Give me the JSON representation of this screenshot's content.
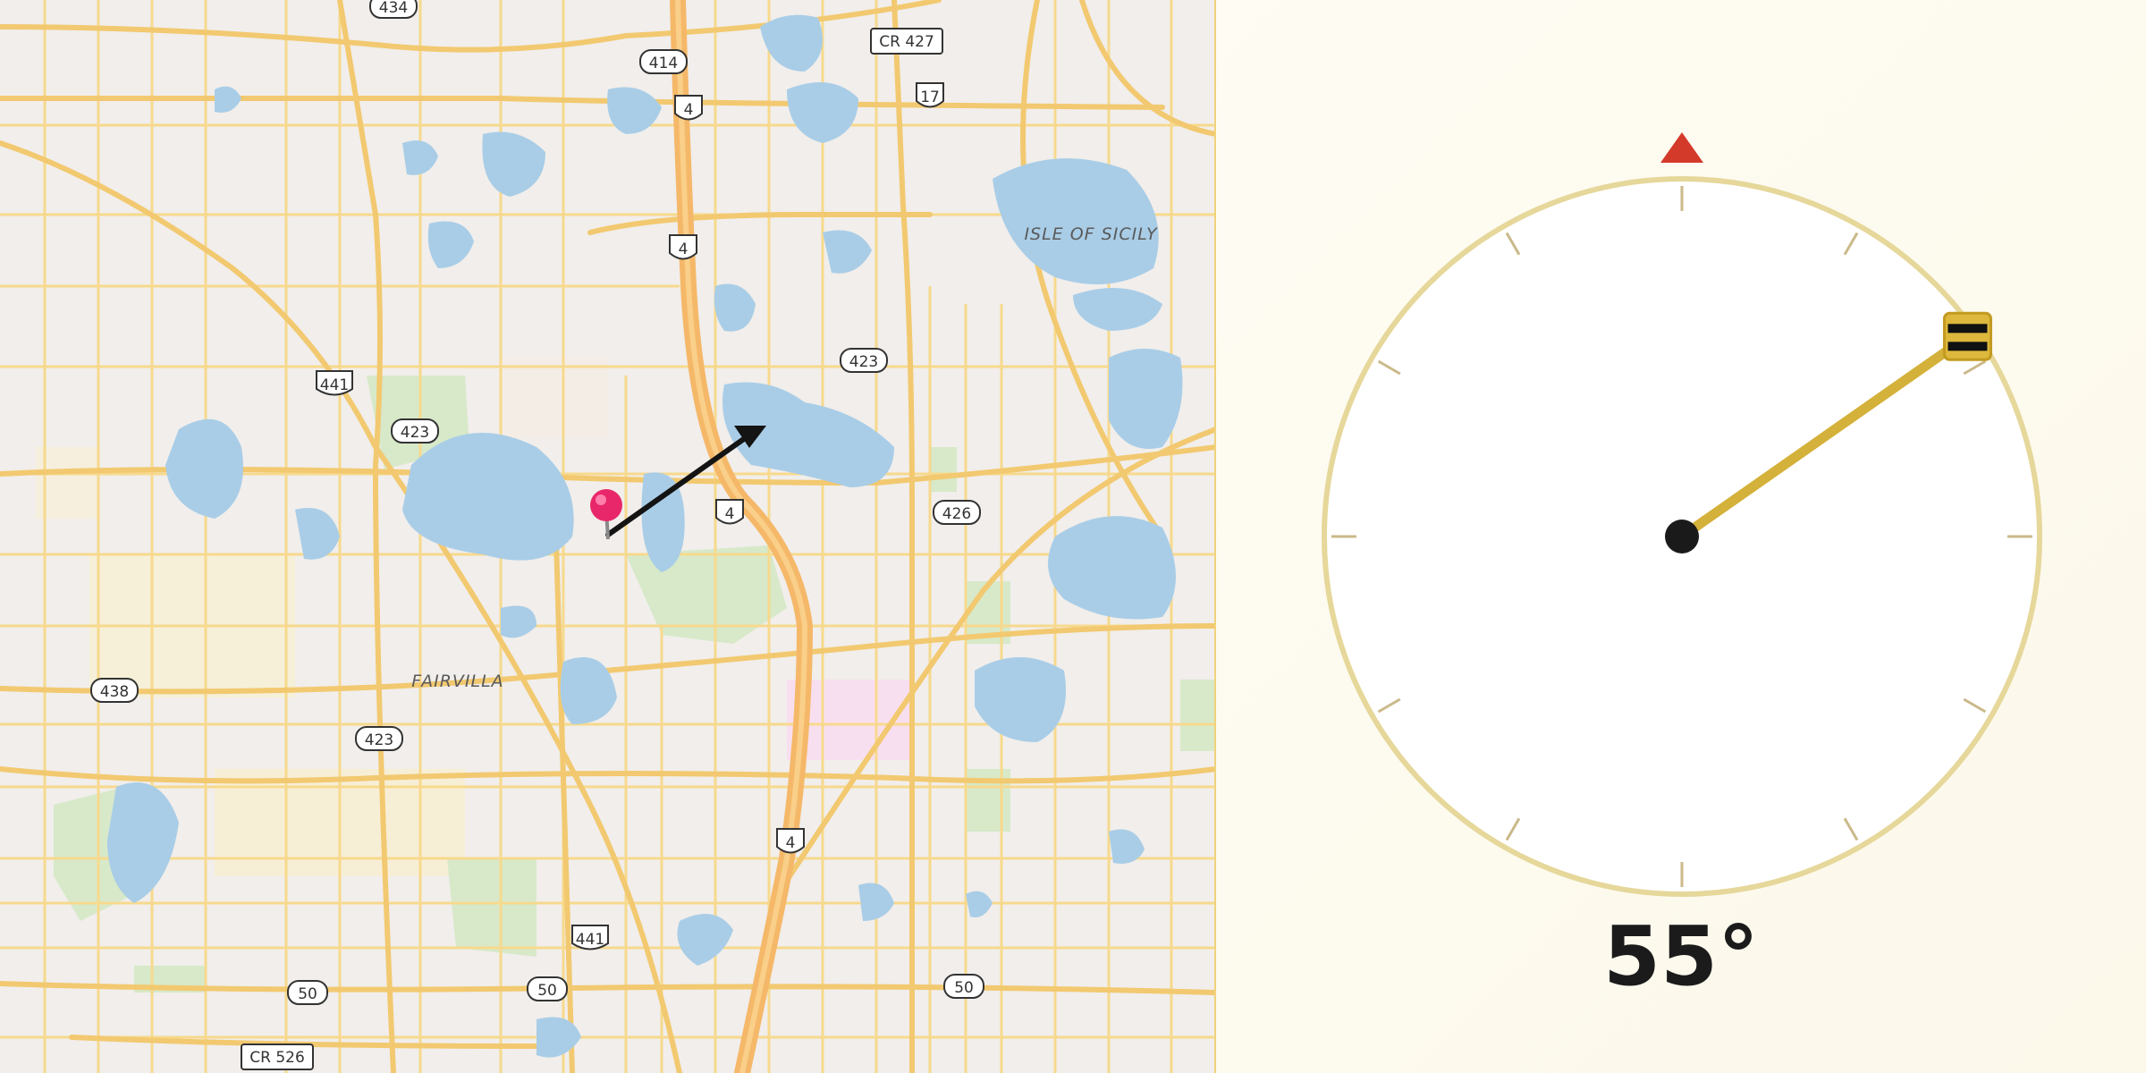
{
  "map": {
    "place_labels": [
      "ISLE OF SICILY",
      "FAIRVILLA"
    ],
    "route_shields": [
      "434",
      "414",
      "CR 427",
      "17",
      "4",
      "4",
      "4",
      "4",
      "441",
      "423",
      "423",
      "423",
      "426",
      "438",
      "441",
      "50",
      "50",
      "50",
      "CR 526"
    ],
    "marker": "map-pin",
    "heading_arrow_deg": 55
  },
  "compass": {
    "heading_deg": 55,
    "heading_label": "55°",
    "north_marker_color": "#d43a2a",
    "needle_color": "#d4b13a",
    "dial_color": "#e6d79a"
  }
}
